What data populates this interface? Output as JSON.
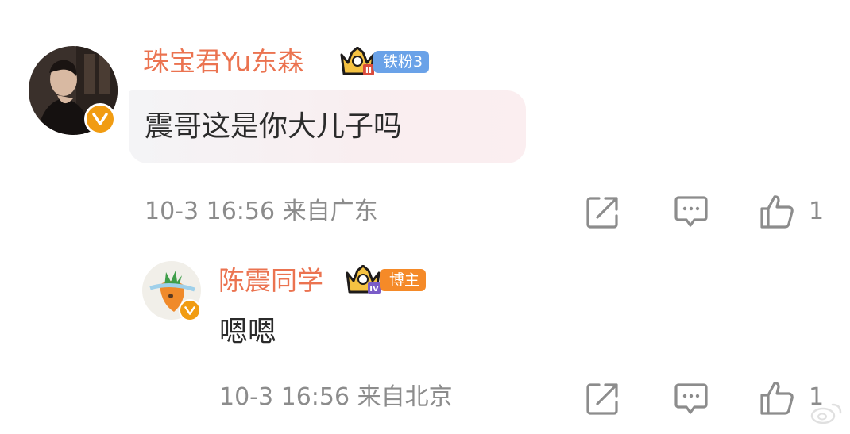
{
  "comment": {
    "username": "珠宝君Yu东森",
    "fan_badge": "铁粉3",
    "text": "震哥这是你大儿子吗",
    "time": "10-3 16:56",
    "location": "来自广东",
    "like_count": "1"
  },
  "reply": {
    "username": "陈震同学",
    "role_badge": "博主",
    "text": "嗯嗯",
    "time": "10-3 16:56",
    "location": "来自北京",
    "like_count": "1"
  },
  "icons": {
    "verified": "v-badge-icon",
    "crown_level_2": "crown-ii-icon",
    "crown_level_4": "crown-iv-icon",
    "share": "share-icon",
    "comment": "comment-icon",
    "like": "thumbs-up-icon"
  },
  "colors": {
    "username": "#eb7350",
    "fan_badge": "#6aa2e8",
    "host_badge": "#f58a28",
    "verified": "#f19c12",
    "meta_text": "#8c8c8c"
  }
}
